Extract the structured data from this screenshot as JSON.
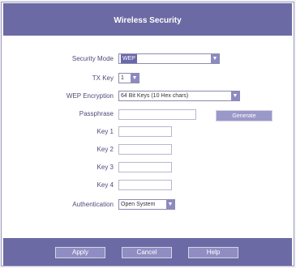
{
  "title": "Wireless Security",
  "fields": {
    "security_mode": {
      "label": "Security Mode",
      "value": "WEP"
    },
    "tx_key": {
      "label": "TX Key",
      "value": "1"
    },
    "wep_encryption": {
      "label": "WEP Encryption",
      "value": "64 Bit Keys (10 Hex chars)"
    },
    "passphrase": {
      "label": "Passphrase",
      "value": ""
    },
    "key1": {
      "label": "Key 1",
      "value": ""
    },
    "key2": {
      "label": "Key 2",
      "value": ""
    },
    "key3": {
      "label": "Key 3",
      "value": ""
    },
    "key4": {
      "label": "Key 4",
      "value": ""
    },
    "authentication": {
      "label": "Authentication",
      "value": "Open System"
    }
  },
  "generate_label": "Generate",
  "footer": {
    "apply": "Apply",
    "cancel": "Cancel",
    "help": "Help"
  },
  "colors": {
    "header": "#6c6aa4",
    "button": "#8f8dc2",
    "highlight": "#6a68aa"
  }
}
